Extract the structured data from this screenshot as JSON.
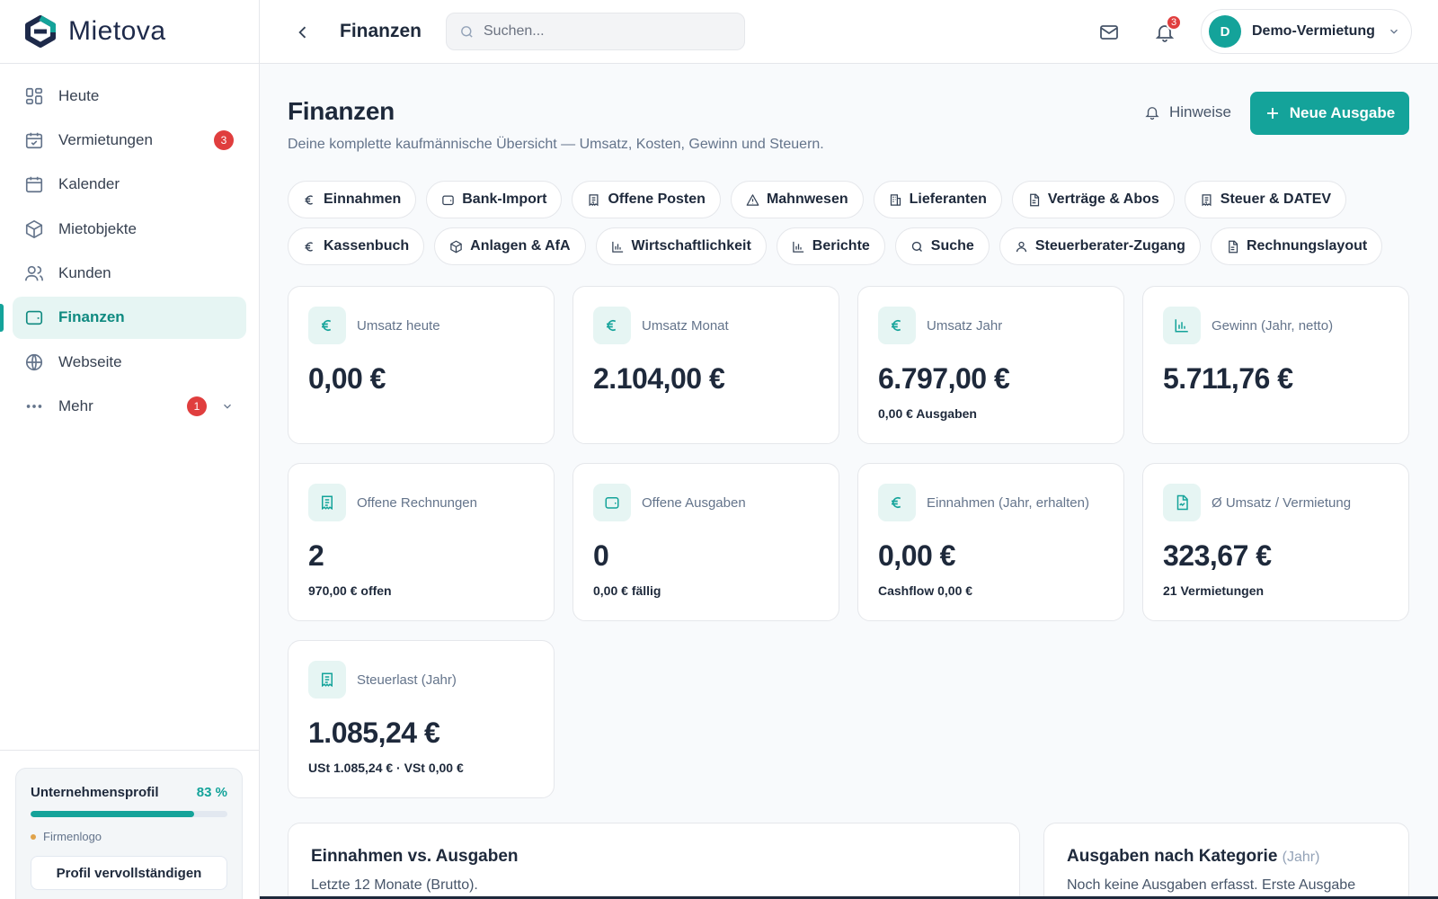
{
  "app": {
    "name": "Mietova"
  },
  "sidebar": {
    "items": [
      {
        "label": "Heute",
        "icon": "grid-icon"
      },
      {
        "label": "Vermietungen",
        "icon": "calendar-check-icon",
        "badge": "3"
      },
      {
        "label": "Kalender",
        "icon": "calendar-icon"
      },
      {
        "label": "Mietobjekte",
        "icon": "box-icon"
      },
      {
        "label": "Kunden",
        "icon": "users-icon"
      },
      {
        "label": "Finanzen",
        "icon": "wallet-icon",
        "active": true
      },
      {
        "label": "Webseite",
        "icon": "globe-icon"
      },
      {
        "label": "Mehr",
        "icon": "more-icon",
        "badge": "1"
      }
    ],
    "profile": {
      "title": "Unternehmensprofil",
      "percent_label": "83 %",
      "percent": 83,
      "todo": "Firmenlogo",
      "button": "Profil vervollständigen"
    }
  },
  "topbar": {
    "title": "Finanzen",
    "search_placeholder": "Suchen...",
    "notification_count": "3",
    "account_initial": "D",
    "account_name": "Demo-Vermietung"
  },
  "page": {
    "title": "Finanzen",
    "subtitle": "Deine komplette kaufmännische Übersicht — Umsatz, Kosten, Gewinn und Steuern.",
    "hint_button": "Hinweise",
    "primary_button": "Neue Ausgabe"
  },
  "tabs_row1": [
    {
      "label": "Einnahmen",
      "icon": "euro-icon"
    },
    {
      "label": "Bank-Import",
      "icon": "wallet-icon"
    },
    {
      "label": "Offene Posten",
      "icon": "receipt-icon"
    },
    {
      "label": "Mahnwesen",
      "icon": "alert-triangle-icon"
    },
    {
      "label": "Lieferanten",
      "icon": "building-icon"
    },
    {
      "label": "Verträge & Abos",
      "icon": "file-icon"
    },
    {
      "label": "Steuer & DATEV",
      "icon": "receipt-icon"
    }
  ],
  "tabs_row2": [
    {
      "label": "Kassenbuch",
      "icon": "euro-icon"
    },
    {
      "label": "Anlagen & AfA",
      "icon": "box-icon"
    },
    {
      "label": "Wirtschaftlichkeit",
      "icon": "bar-chart-icon"
    },
    {
      "label": "Berichte",
      "icon": "bar-chart-icon"
    },
    {
      "label": "Suche",
      "icon": "search-icon"
    },
    {
      "label": "Steuerberater-Zugang",
      "icon": "user-icon"
    },
    {
      "label": "Rechnungslayout",
      "icon": "file-icon"
    }
  ],
  "kpis": [
    {
      "label": "Umsatz heute",
      "value": "0,00 €",
      "note": "",
      "icon": "euro-icon"
    },
    {
      "label": "Umsatz Monat",
      "value": "2.104,00 €",
      "note": "",
      "icon": "euro-icon"
    },
    {
      "label": "Umsatz Jahr",
      "value": "6.797,00 €",
      "note": "0,00 € Ausgaben",
      "icon": "euro-icon"
    },
    {
      "label": "Gewinn (Jahr, netto)",
      "value": "5.711,76 €",
      "note": "",
      "icon": "bar-chart-icon"
    },
    {
      "label": "Offene Rechnungen",
      "value": "2",
      "note": "970,00 € offen",
      "icon": "receipt-icon"
    },
    {
      "label": "Offene Ausgaben",
      "value": "0",
      "note": "0,00 € fällig",
      "icon": "wallet-icon"
    },
    {
      "label": "Einnahmen (Jahr, erhalten)",
      "value": "0,00 €",
      "note": "Cashflow 0,00 €",
      "icon": "euro-icon"
    },
    {
      "label": "Ø Umsatz / Vermietung",
      "value": "323,67 €",
      "note": "21 Vermietungen",
      "icon": "file-chart-icon"
    },
    {
      "label": "Steuerlast (Jahr)",
      "value": "1.085,24 €",
      "note": "USt 1.085,24 € · VSt 0,00 €",
      "icon": "receipt-icon"
    }
  ],
  "panels": {
    "income_vs_expenses": {
      "title": "Einnahmen vs. Ausgaben",
      "subtitle": "Letzte 12 Monate (Brutto)."
    },
    "expenses_by_category": {
      "title": "Ausgaben nach Kategorie",
      "title_suffix": "(Jahr)",
      "subtitle": "Noch keine Ausgaben erfasst. Erste Ausgabe"
    }
  },
  "colors": {
    "accent": "#14a39a",
    "badge": "#e03e3e",
    "text": "#1e293b"
  }
}
